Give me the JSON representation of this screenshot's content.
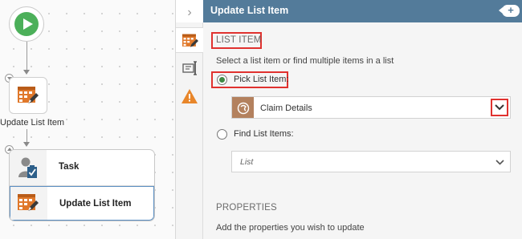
{
  "canvas": {
    "list_node_label": "Update List Item",
    "group_rows": [
      {
        "label": "Task"
      },
      {
        "label": "Update List Item"
      }
    ]
  },
  "header": {
    "title": "Update List Item",
    "action_glyph": "+"
  },
  "panel": {
    "section_list_item": "LIST ITEM",
    "description": "Select a list item or find multiple items in a list",
    "pick_label": "Pick List Item:",
    "pick_value": "Claim Details",
    "find_label": "Find List Items:",
    "find_placeholder": "List",
    "section_properties": "PROPERTIES",
    "properties_description": "Add the properties you wish to update"
  },
  "icons": {
    "start": "play-icon",
    "list_item": "list-edit-icon",
    "task": "user-task-icon",
    "tab_general": "list-edit-icon",
    "tab_form": "form-field-icon",
    "tab_warning": "warning-icon",
    "source": "sharepoint-list-icon"
  },
  "colors": {
    "header_bg": "#537b9a",
    "accent_orange": "#e0782a",
    "highlight_red": "#e0322f",
    "radio_green": "#3f8a45",
    "start_green": "#4cb05a",
    "warning_orange": "#e8862a",
    "selected_border": "#5b8fc3"
  }
}
